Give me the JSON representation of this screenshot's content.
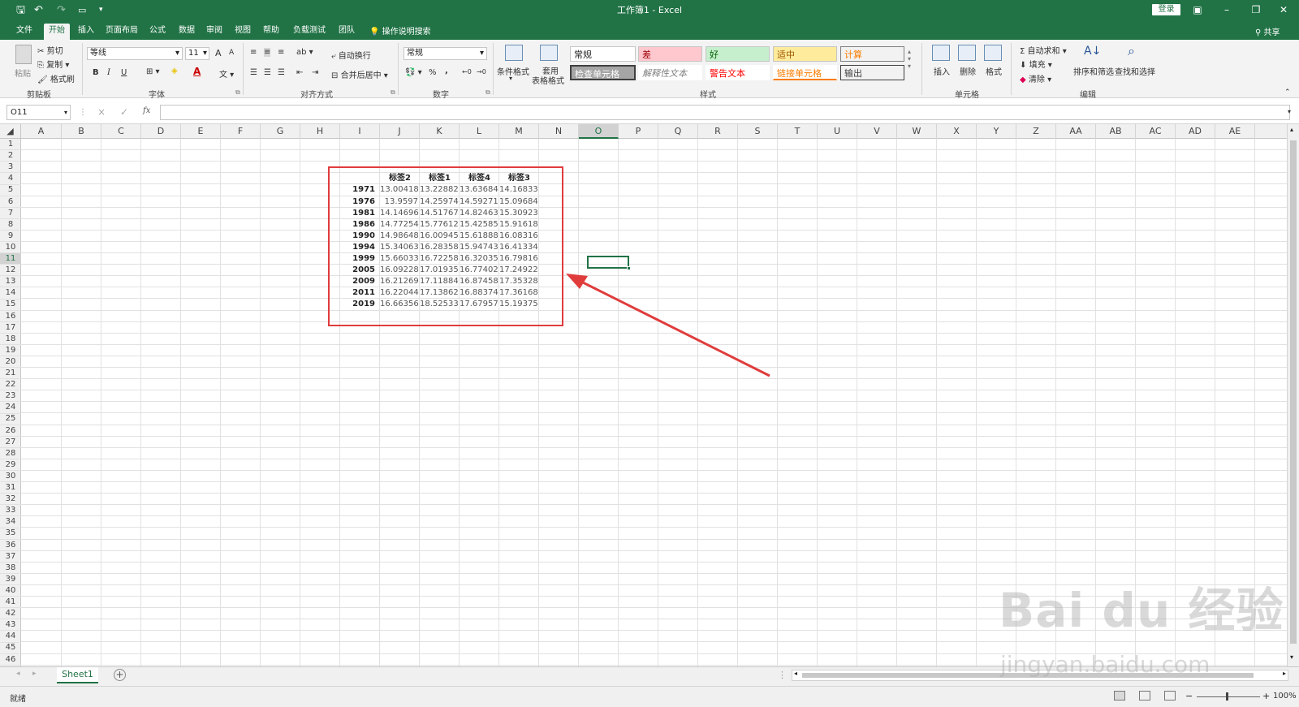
{
  "titlebar": {
    "title": "工作簿1 - Excel",
    "login": "登录",
    "colors": {
      "bg": "#217346"
    }
  },
  "tabs": [
    "文件",
    "开始",
    "插入",
    "页面布局",
    "公式",
    "数据",
    "审阅",
    "视图",
    "帮助",
    "负载测试",
    "团队"
  ],
  "active_tab": "开始",
  "search_placeholder": "操作说明搜索",
  "share": "共享",
  "ribbon": {
    "clipboard": {
      "paste": "粘贴",
      "cut": "剪切",
      "copy": "复制",
      "format_painter": "格式刷",
      "label": "剪贴板"
    },
    "font": {
      "name": "等线",
      "size": "11",
      "bold": "B",
      "italic": "I",
      "underline": "U",
      "grow": "A",
      "shrink": "A",
      "color": "A",
      "label": "字体"
    },
    "alignment": {
      "wrap": "自动换行",
      "merge": "合并后居中",
      "label": "对齐方式"
    },
    "number": {
      "format": "常规",
      "percent": "%",
      "comma": ",",
      "label": "数字"
    },
    "styles": {
      "conditional": "条件格式",
      "table_fmt_1": "套用",
      "table_fmt_2": "表格格式",
      "label": "样式",
      "cells": [
        {
          "text": "常规",
          "bg": "#ffffff",
          "fg": "#222222"
        },
        {
          "text": "差",
          "bg": "#ffc7ce",
          "fg": "#9c0006"
        },
        {
          "text": "好",
          "bg": "#c6efce",
          "fg": "#006100"
        },
        {
          "text": "适中",
          "bg": "#ffeb9c",
          "fg": "#9c5700"
        },
        {
          "text": "计算",
          "bg": "#f2f2f2",
          "fg": "#fa7d00"
        },
        {
          "text": "检查单元格",
          "bg": "#a5a5a5",
          "fg": "#ffffff"
        },
        {
          "text": "解释性文本",
          "bg": "#ffffff",
          "fg": "#7f7f7f"
        },
        {
          "text": "警告文本",
          "bg": "#ffffff",
          "fg": "#ff0000"
        },
        {
          "text": "链接单元格",
          "bg": "#ffffff",
          "fg": "#fa7d00"
        },
        {
          "text": "输出",
          "bg": "#f2f2f2",
          "fg": "#3f3f3f"
        }
      ]
    },
    "cells_group": {
      "insert": "插入",
      "delete": "删除",
      "format": "格式",
      "label": "单元格"
    },
    "editing": {
      "autosum": "自动求和",
      "fill": "填充",
      "clear": "清除",
      "sort": "排序和筛选",
      "find": "查找和选择",
      "label": "编辑"
    }
  },
  "formula_bar": {
    "name_box": "O11",
    "fx": "fx",
    "cancel": "×",
    "enter": "✓"
  },
  "columns": [
    "A",
    "B",
    "C",
    "D",
    "E",
    "F",
    "G",
    "H",
    "I",
    "J",
    "K",
    "L",
    "M",
    "N",
    "O",
    "P",
    "Q",
    "R",
    "S",
    "T",
    "U",
    "V",
    "W",
    "X",
    "Y",
    "Z",
    "AA",
    "AB",
    "AC",
    "AD",
    "AE"
  ],
  "selected_column": "O",
  "selected_row": 11,
  "row_count": 46,
  "table": {
    "headers": [
      "标签2",
      "标签1",
      "标签4",
      "标签3"
    ],
    "rows": [
      {
        "year": "1971",
        "values": [
          "13.00418",
          "13.22882",
          "13.63684",
          "14.16833"
        ]
      },
      {
        "year": "1976",
        "values": [
          "13.9597",
          "14.25974",
          "14.59271",
          "15.09684"
        ]
      },
      {
        "year": "1981",
        "values": [
          "14.14696",
          "14.51767",
          "14.82463",
          "15.30923"
        ]
      },
      {
        "year": "1986",
        "values": [
          "14.77254",
          "15.77612",
          "15.42585",
          "15.91618"
        ]
      },
      {
        "year": "1990",
        "values": [
          "14.98648",
          "16.00945",
          "15.61888",
          "16.08316"
        ]
      },
      {
        "year": "1994",
        "values": [
          "15.34063",
          "16.28358",
          "15.94743",
          "16.41334"
        ]
      },
      {
        "year": "1999",
        "values": [
          "15.66033",
          "16.72258",
          "16.32035",
          "16.79816"
        ]
      },
      {
        "year": "2005",
        "values": [
          "16.09228",
          "17.01935",
          "16.77402",
          "17.24922"
        ]
      },
      {
        "year": "2009",
        "values": [
          "16.21269",
          "17.11884",
          "16.87458",
          "17.35328"
        ]
      },
      {
        "year": "2011",
        "values": [
          "16.22044",
          "17.13862",
          "16.88374",
          "17.36168"
        ]
      },
      {
        "year": "2019",
        "values": [
          "16.66356",
          "18.52533",
          "17.67957",
          "15.19375"
        ]
      }
    ]
  },
  "sheet_tab": "Sheet1",
  "status": {
    "ready": "就绪",
    "zoom": "100%"
  },
  "watermark": {
    "main": "Bai du 经验",
    "sub": "jingyan.baidu.com"
  },
  "annotation_color": "#e03c3c"
}
